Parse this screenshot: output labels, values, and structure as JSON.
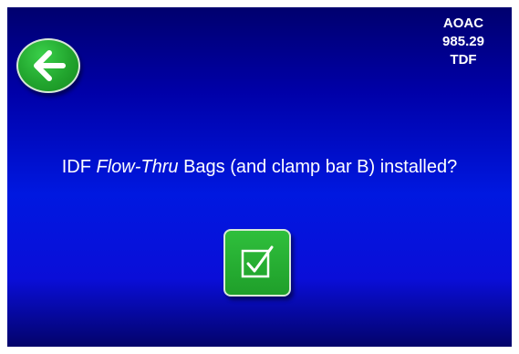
{
  "header": {
    "method_line1": "AOAC",
    "method_line2": "985.29",
    "method_line3": "TDF",
    "back_icon": "arrow-left-icon"
  },
  "prompt": {
    "prefix": "IDF ",
    "italic": "Flow-Thru",
    "suffix": " Bags (and clamp bar B) installed?"
  },
  "actions": {
    "confirm_icon": "checkbox-check-icon"
  },
  "colors": {
    "background_top": "#00006e",
    "background_mid": "#0018e0",
    "button_green": "#22a52e",
    "text": "#ffffff"
  }
}
